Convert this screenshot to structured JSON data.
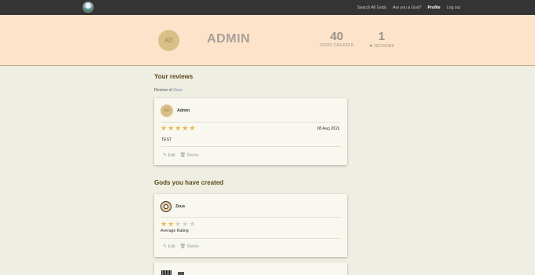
{
  "nav": {
    "links": [
      {
        "label": "Search All Gods",
        "active": false
      },
      {
        "label": "Are you a God?",
        "active": false
      },
      {
        "label": "Profile",
        "active": true
      },
      {
        "label": "Log out",
        "active": false
      }
    ]
  },
  "profile": {
    "initials": "AD",
    "username": "ADMIN",
    "gods_created_count": "40",
    "gods_created_label": "GODS CREATED",
    "reviews_count": "1",
    "reviews_label": "REVIEWS"
  },
  "reviews_section": {
    "title": "Your reviews",
    "review_of_prefix": "Review of",
    "review_of_link": "Zeus",
    "review": {
      "author_initials": "AD",
      "author_name": "Admin",
      "rating": 5,
      "date": "08 Aug 2021",
      "text": "TEST",
      "edit_label": "Edit",
      "delete_label": "Delete"
    }
  },
  "gods_section": {
    "title": "Gods you have created",
    "god": {
      "name": "Zeus",
      "rating": 2,
      "rating_label": "Average Rating",
      "edit_label": "Edit",
      "delete_label": "Delete"
    }
  },
  "colors": {
    "navbar": "#343434",
    "banner": "#fce3c9",
    "background": "#efeee2",
    "star_on": "#e8b84a",
    "star_off": "#cfcfcf"
  },
  "icons": {
    "edit": "edit-icon",
    "delete": "trash-icon",
    "star": "star-icon"
  }
}
